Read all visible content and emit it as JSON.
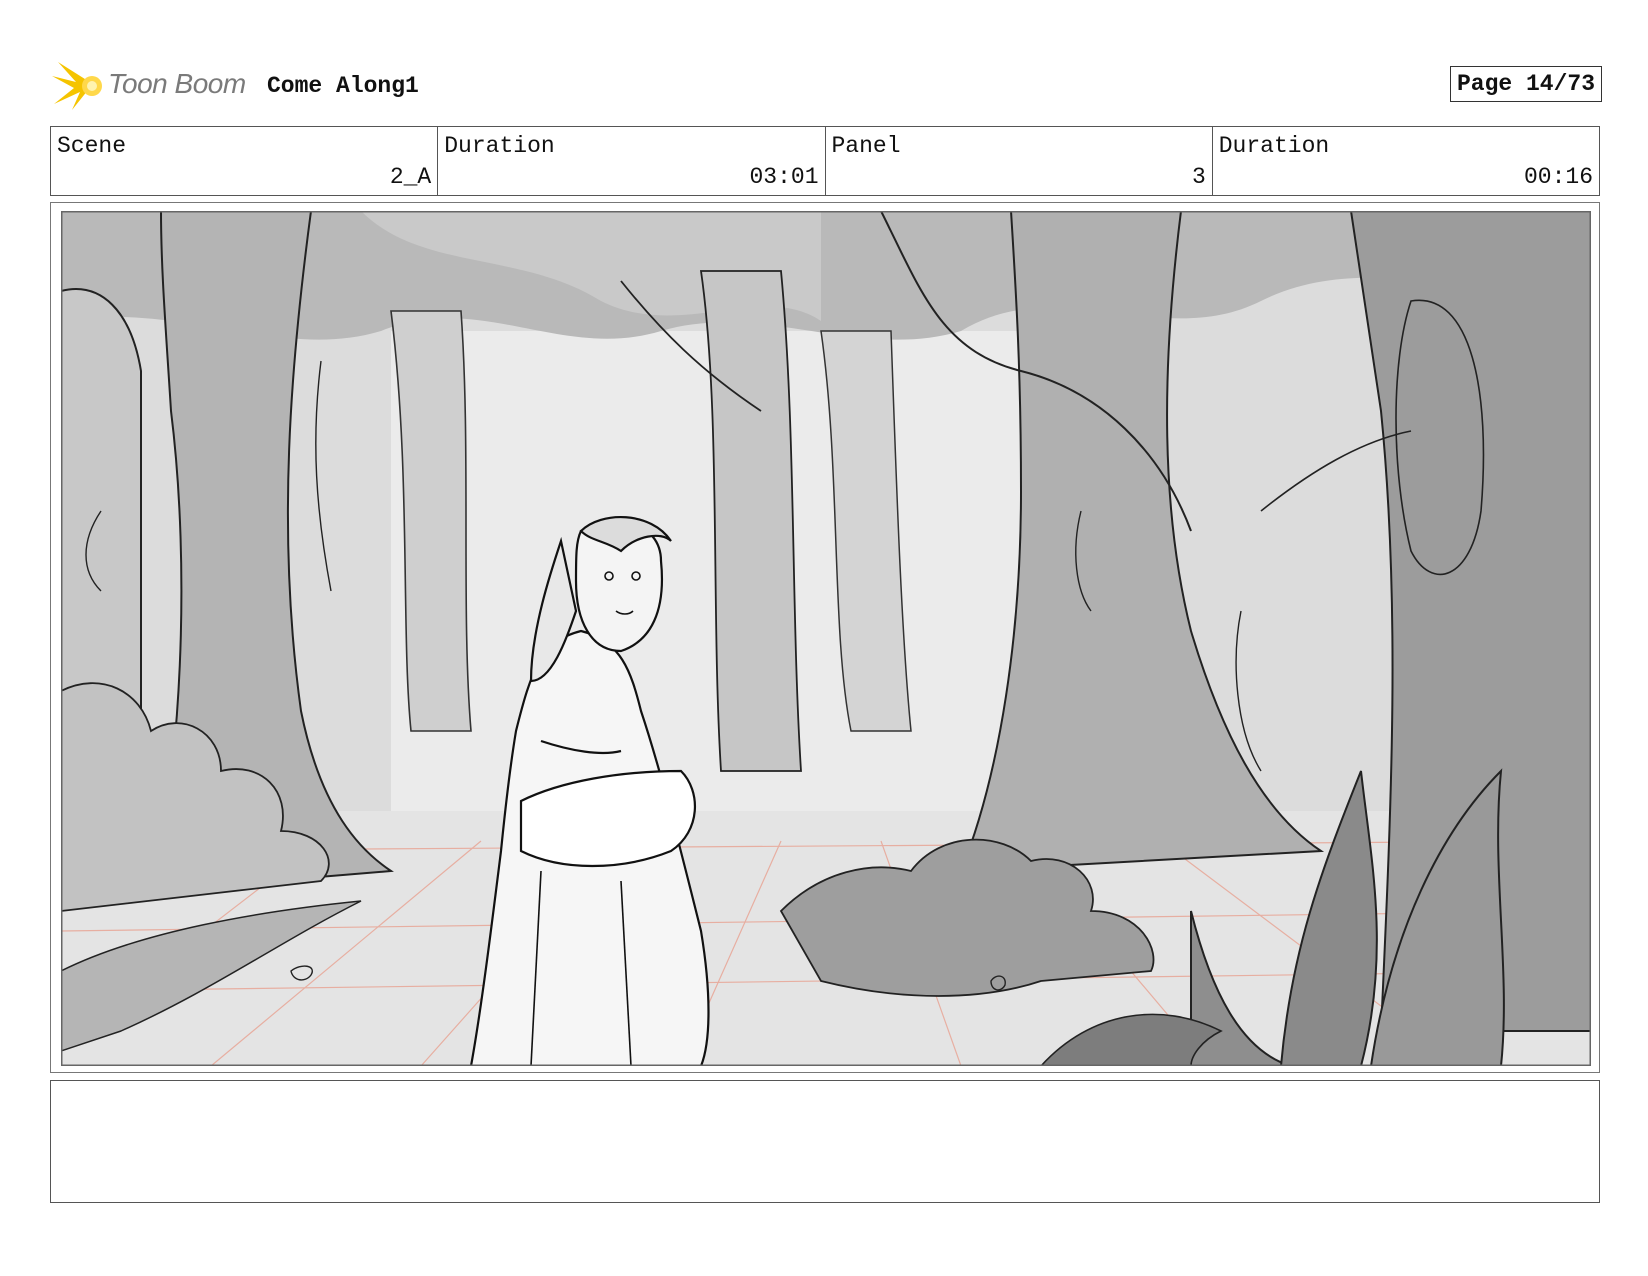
{
  "header": {
    "logo_text": "Toon Boom",
    "project_title": "Come Along1",
    "page_label": "Page 14/73"
  },
  "info": {
    "scene_label": "Scene",
    "scene_value": "2_A",
    "scene_duration_label": "Duration",
    "scene_duration_value": "03:01",
    "panel_label": "Panel",
    "panel_value": "3",
    "panel_duration_label": "Duration",
    "panel_duration_value": "00:16"
  },
  "notes": {
    "text": ""
  },
  "colors": {
    "logo_accent": "#f2b705",
    "perspective_grid": "#e8a99a"
  }
}
